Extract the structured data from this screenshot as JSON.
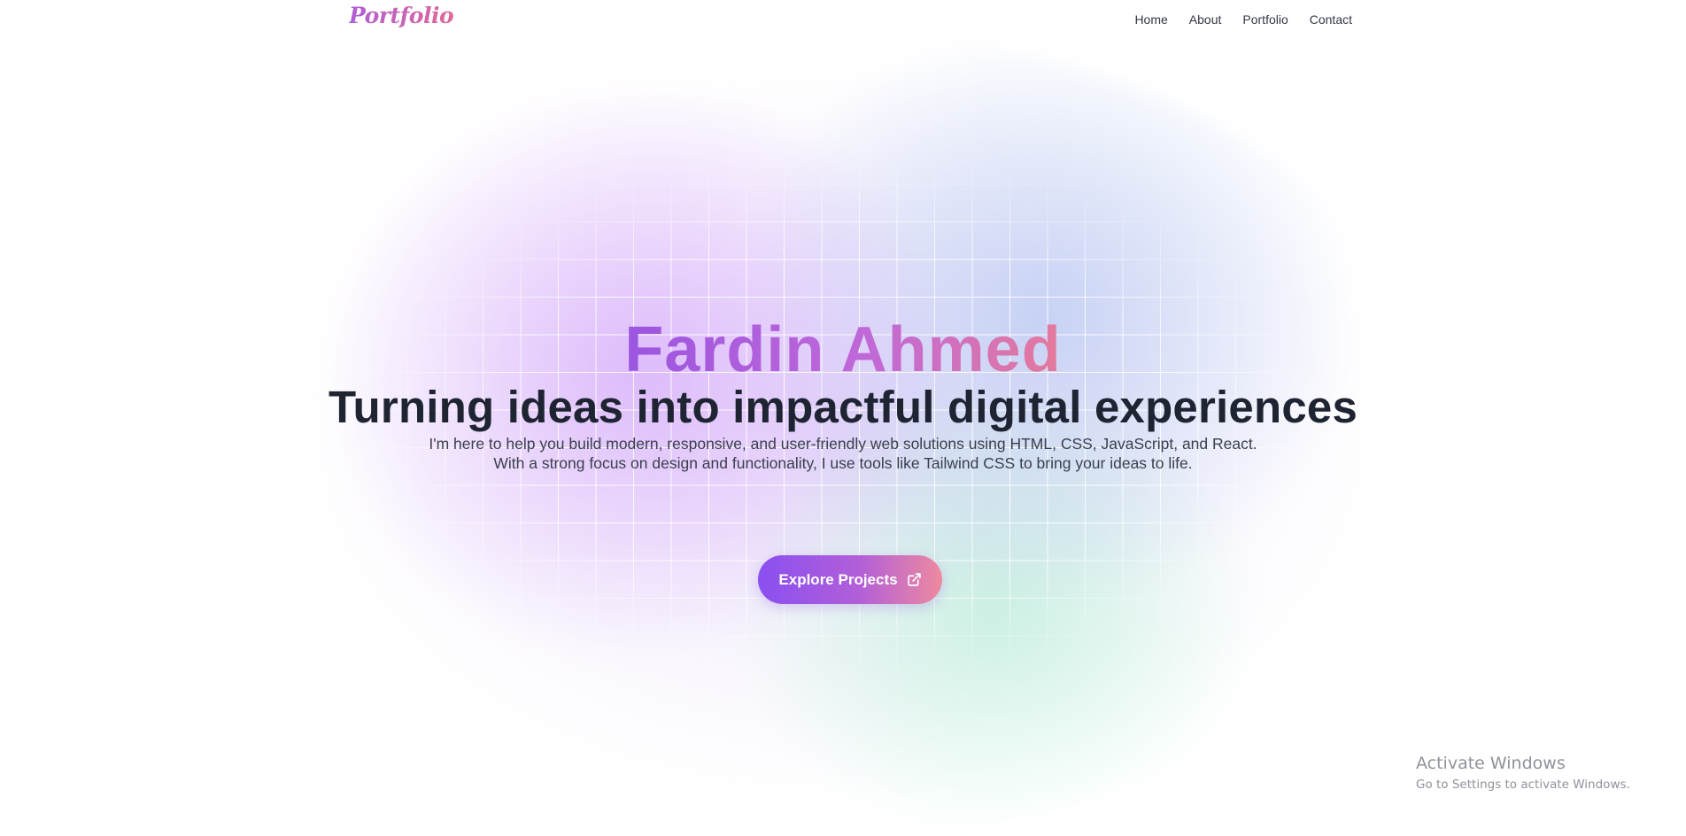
{
  "navbar": {
    "logo": "Portfolio",
    "links": [
      "Home",
      "About",
      "Portfolio",
      "Contact"
    ]
  },
  "hero": {
    "name": "Fardin Ahmed",
    "tagline": "Turning ideas into impactful digital experiences",
    "description_line1": "I'm here to help you build modern, responsive, and user-friendly web solutions using HTML, CSS, JavaScript, and React.",
    "description_line2": "With a strong focus on design and functionality, I use tools like Tailwind CSS to bring your ideas to life.",
    "cta_label": "Explore Projects",
    "cta_icon": "external-link-icon"
  },
  "watermark": {
    "title": "Activate Windows",
    "subtitle": "Go to Settings to activate Windows."
  },
  "colors": {
    "brand_purple": "#8a4ff0",
    "brand_pink": "#ee8aa0",
    "heading_dark": "#1f2433",
    "body_text": "#3a3f4d"
  }
}
